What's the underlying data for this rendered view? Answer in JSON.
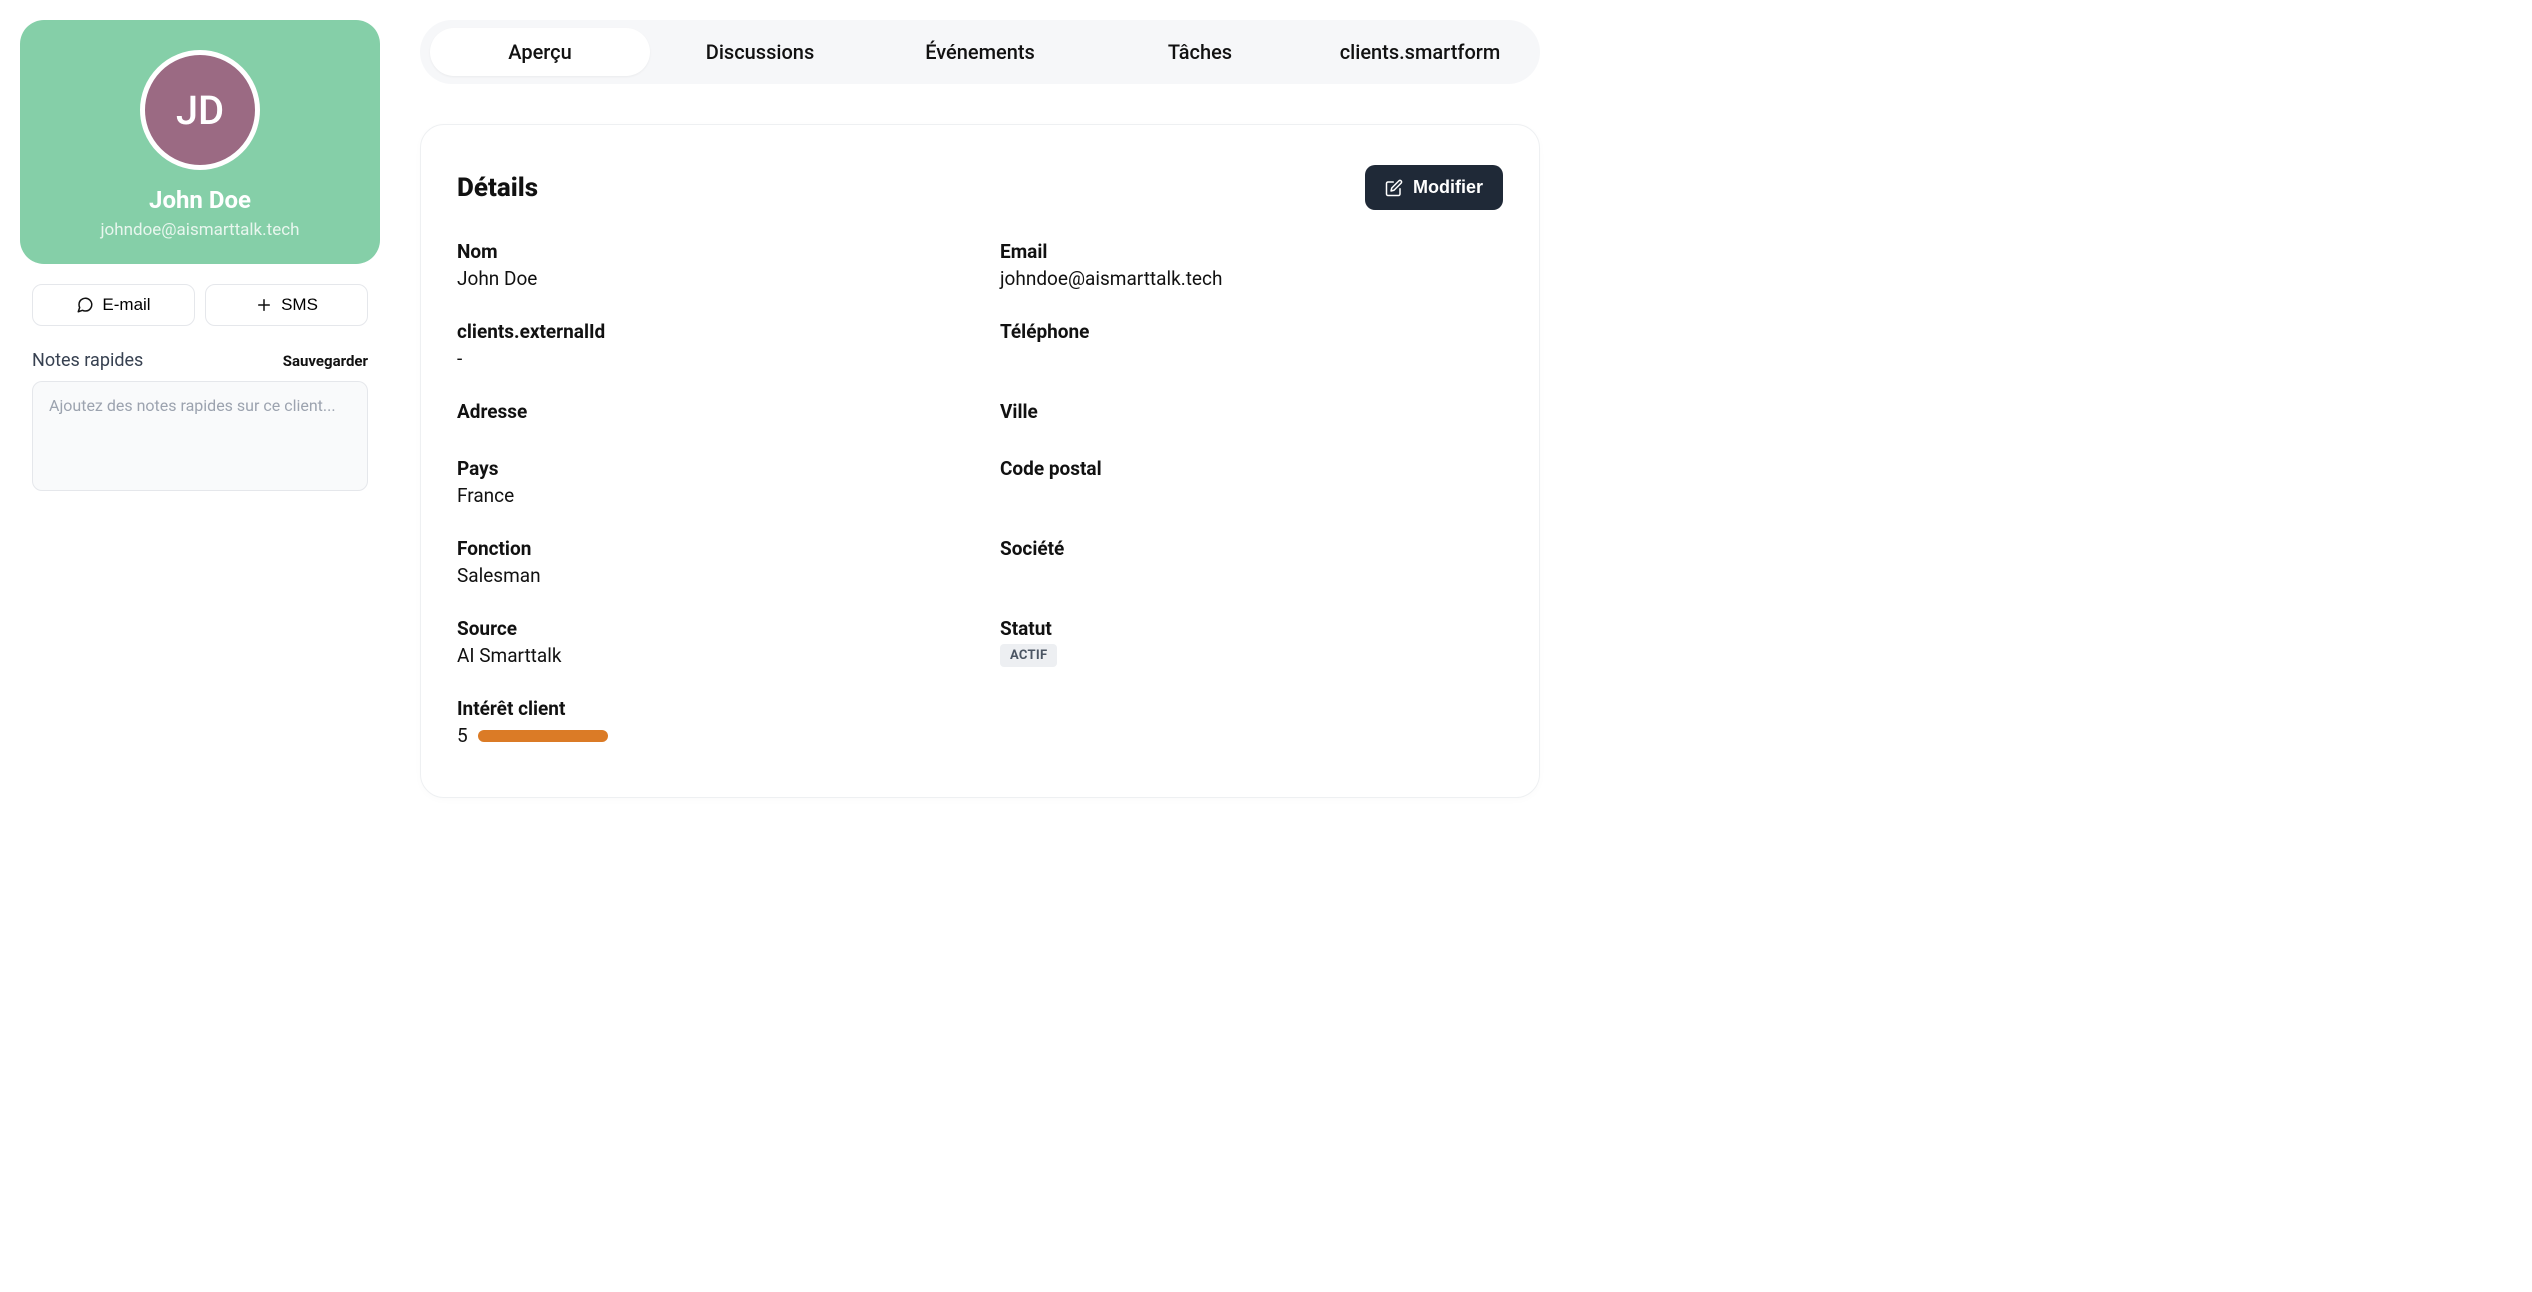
{
  "profile": {
    "initials": "JD",
    "name": "John Doe",
    "email": "johndoe@aismarttalk.tech",
    "avatar_bg": "#9b6a83",
    "header_bg": "#85cfa8"
  },
  "actions": {
    "email_label": "E-mail",
    "sms_label": "SMS"
  },
  "notes": {
    "label": "Notes rapides",
    "save_label": "Sauvegarder",
    "placeholder": "Ajoutez des notes rapides sur ce client..."
  },
  "tabs": {
    "items": [
      {
        "label": "Aperçu",
        "active": true
      },
      {
        "label": "Discussions",
        "active": false
      },
      {
        "label": "Événements",
        "active": false
      },
      {
        "label": "Tâches",
        "active": false
      },
      {
        "label": "clients.smartform",
        "active": false
      }
    ]
  },
  "panel": {
    "title": "Détails",
    "edit_label": "Modifier"
  },
  "details": {
    "name_label": "Nom",
    "name_value": "John Doe",
    "email_label": "Email",
    "email_value": "johndoe@aismarttalk.tech",
    "externalId_label": "clients.externalId",
    "externalId_value": "-",
    "phone_label": "Téléphone",
    "phone_value": "",
    "address_label": "Adresse",
    "address_value": "",
    "city_label": "Ville",
    "city_value": "",
    "country_label": "Pays",
    "country_value": "France",
    "postal_label": "Code postal",
    "postal_value": "",
    "function_label": "Fonction",
    "function_value": "Salesman",
    "company_label": "Société",
    "company_value": "",
    "source_label": "Source",
    "source_value": "AI Smarttalk",
    "status_label": "Statut",
    "status_value": "ACTIF",
    "interest_label": "Intérêt client",
    "interest_value": "5",
    "interest_color": "#db7b26"
  }
}
